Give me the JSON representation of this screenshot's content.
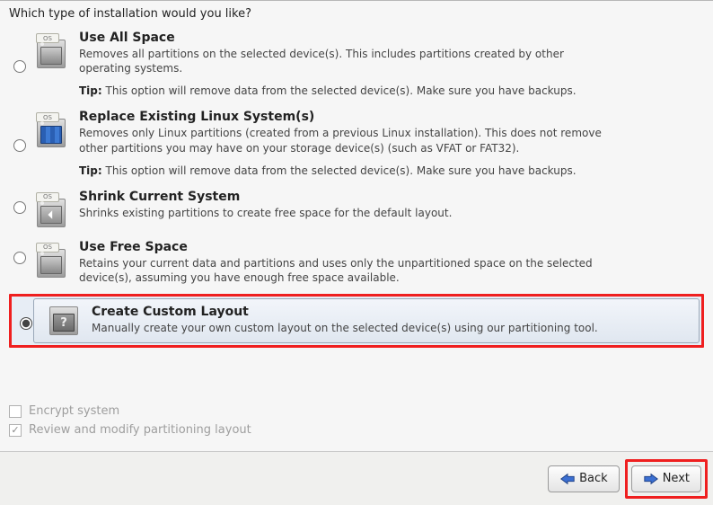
{
  "page": {
    "title": "Which type of installation would you like?"
  },
  "options": [
    {
      "title": "Use All Space",
      "desc": "Removes all partitions on the selected device(s).  This includes partitions created by other operating systems.",
      "tip_label": "Tip:",
      "tip_text": "This option will remove data from the selected device(s).  Make sure you have backups.",
      "selected": false
    },
    {
      "title": "Replace Existing Linux System(s)",
      "desc": "Removes only Linux partitions (created from a previous Linux installation).  This does not remove other partitions you may have on your storage device(s) (such as VFAT or FAT32).",
      "tip_label": "Tip:",
      "tip_text": "This option will remove data from the selected device(s).  Make sure you have backups.",
      "selected": false
    },
    {
      "title": "Shrink Current System",
      "desc": "Shrinks existing partitions to create free space for the default layout.",
      "selected": false
    },
    {
      "title": "Use Free Space",
      "desc": "Retains your current data and partitions and uses only the unpartitioned space on the selected device(s), assuming you have enough free space available.",
      "selected": false
    },
    {
      "title": "Create Custom Layout",
      "desc": "Manually create your own custom layout on the selected device(s) using our partitioning tool.",
      "selected": true
    }
  ],
  "icons": {
    "os_tag_text": "OS"
  },
  "checks": {
    "encrypt": {
      "label": "Encrypt system",
      "checked": false
    },
    "review": {
      "label": "Review and modify partitioning layout",
      "checked": true
    }
  },
  "footer": {
    "back": "Back",
    "next": "Next"
  }
}
